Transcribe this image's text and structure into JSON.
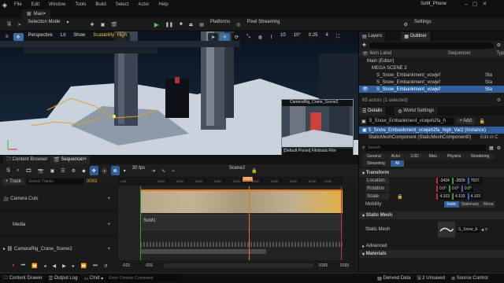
{
  "app": {
    "project_name": "SoM_Phone"
  },
  "menu": [
    "File",
    "Edit",
    "Window",
    "Tools",
    "Build",
    "Select",
    "Actor",
    "Help"
  ],
  "tab": {
    "label": "Main•"
  },
  "toolbar": {
    "selection_mode": "Selection Mode",
    "platforms": "Platforms",
    "pixel_streaming": "Pixel Streaming",
    "settings": "Settings"
  },
  "viewport": {
    "perspective": "Perspective",
    "lit": "Lit",
    "show": "Show",
    "scalability": "Scalability: High",
    "snap_angle": "10°",
    "snap_scale": "0.25",
    "camera_speed": "4",
    "grid_size": "10",
    "preview_title": "CameraRig_Crane_Scene2",
    "preview_caption": "[Default Preset] Filmback Film"
  },
  "layers": {
    "tabs": [
      "Layers",
      "Outliner"
    ],
    "col_item_label": "Item Label",
    "col_sequencer": "Sequencer",
    "col_type": "Typ",
    "rows": [
      {
        "label": "Main (Editor)",
        "type": ""
      },
      {
        "label": "MEGA SCENE 2",
        "type": ""
      },
      {
        "label": "S_Snow_Embankment_vcwjef",
        "type": "Sta"
      },
      {
        "label": "S_Snow_Embankment_vcwjef",
        "type": "Sta"
      },
      {
        "label": "S_Snow_Embankment_vcwjef",
        "type": "Sta"
      }
    ],
    "actor_count": "65 actors (1 selected)"
  },
  "details": {
    "tabs": [
      "Details",
      "World Settings"
    ],
    "object_name": "S_Snow_Embankment_vcwjeh2fa_h",
    "add_label": "+ Add",
    "instance": "S_Snow_Embankment_vcwjeh2fa_high_Var2 (Instance)",
    "component": "StaticMeshComponent (StaticMeshComponent0)",
    "edit_in_cpp": "Edit in C",
    "search_placeholder": "Search",
    "filters": [
      "General",
      "Actor",
      "LOD",
      "Misc",
      "Physics",
      "Rendering",
      "Streaming",
      "All"
    ],
    "transform_header": "Transform",
    "location_label": "Location",
    "location": [
      "-3434",
      "-2839",
      "7027."
    ],
    "rotation_label": "Rotation",
    "rotation": [
      "0.0°",
      "0.0°",
      "0.0°"
    ],
    "scale_label": "Scale",
    "scale": [
      "4.103",
      "4.103",
      "4.103"
    ],
    "mobility_label": "Mobility",
    "mobility": [
      "Static",
      "Stationary",
      "Mova"
    ],
    "static_mesh_header": "Static Mesh",
    "static_mesh_label": "Static Mesh",
    "static_mesh_value": "S_Snow_E",
    "advanced": "Advanced",
    "materials": "Materials"
  },
  "sequencer": {
    "tabs": [
      "Content Browser",
      "Sequencer×"
    ],
    "fps": "30 fps",
    "scene_name": "Scene2",
    "track_button": "+ Track",
    "search_placeholder": "Search Tracks",
    "current_frame": "0083",
    "playhead_frame": "0083",
    "tracks": [
      "Camera Cuts",
      "Media",
      "CameraRig_Crane_Scene2"
    ],
    "media_section": "SoM1",
    "ruler_ticks": [
      "-015",
      "0015",
      "0030",
      "0045",
      "0060",
      "0075",
      "0090",
      "0105",
      "0120",
      "0135",
      "0150",
      "0165"
    ],
    "range_start": "-015",
    "range_start2": "-015",
    "range_end": "0165",
    "range_end2": "0165"
  },
  "status": {
    "content_drawer": "Content Drawer",
    "output_log": "Output Log",
    "cmd": "Cmd",
    "console_placeholder": "Enter Console Command",
    "derived_data": "Derived Data",
    "unsaved": "2 Unsaved",
    "source_control": "Source Control"
  }
}
